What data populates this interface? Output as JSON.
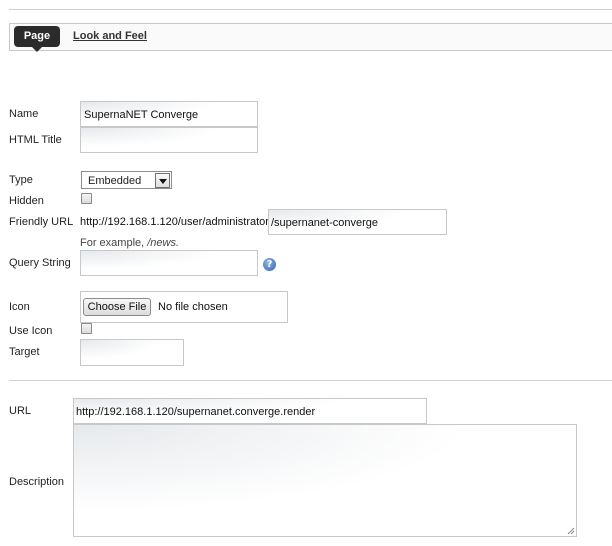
{
  "tabs": {
    "page_label": "Page",
    "look_and_feel_label": "Look and Feel"
  },
  "form": {
    "name_label": "Name",
    "name_value": "SupernaNET Converge",
    "html_title_label": "HTML Title",
    "html_title_value": "",
    "type_label": "Type",
    "type_value": "Embedded",
    "hidden_label": "Hidden",
    "hidden_checked": false,
    "friendly_url_label": "Friendly URL",
    "friendly_url_prefix": "http://192.168.1.120/user/administrator",
    "friendly_url_value": "/supernanet-converge",
    "friendly_url_example_prefix": "For example, ",
    "friendly_url_example_value": "/news.",
    "query_string_label": "Query String",
    "query_string_value": "",
    "icon_label": "Icon",
    "choose_file_label": "Choose File",
    "no_file_label": "No file chosen",
    "use_icon_label": "Use Icon",
    "use_icon_checked": false,
    "target_label": "Target",
    "target_value": "",
    "url_label": "URL",
    "url_value": "http://192.168.1.120/supernanet.converge.render",
    "description_label": "Description",
    "description_value": ""
  },
  "icons": {
    "help": "help-icon",
    "resize": "resize-grip-icon"
  },
  "colors": {
    "active_tab_bg": "#2b2b2b",
    "help_icon": "#2f63b0"
  }
}
